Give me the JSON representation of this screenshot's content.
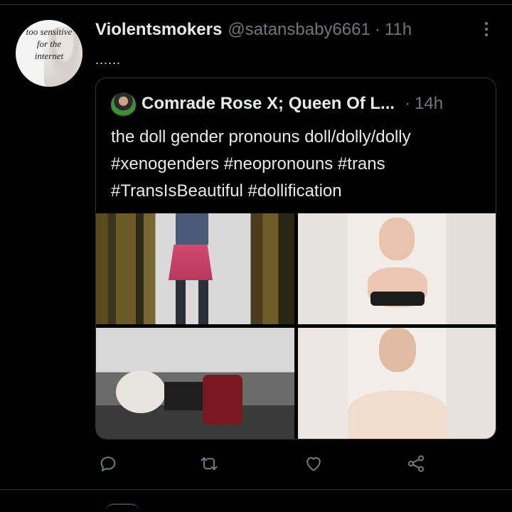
{
  "tweet": {
    "display_name": "Violentsmokers",
    "handle": "@satansbaby6661",
    "separator": "·",
    "time": "11h",
    "text": "......",
    "avatar_text": [
      "too sensitive",
      "for the",
      "internet"
    ],
    "more_icon": "more-dots-icon"
  },
  "quote": {
    "display_name": "Comrade Rose X; Queen Of L...",
    "separator": "·",
    "time": "14h",
    "lines": [
      "the doll gender pronouns doll/dolly/dolly",
      "#xenogenders #neopronouns #trans",
      "#TransIsBeautiful  #dollification"
    ]
  },
  "actions": {
    "reply_icon": "reply-icon",
    "retweet_icon": "retweet-icon",
    "like_icon": "like-icon",
    "share_icon": "share-icon"
  },
  "colors": {
    "background": "#000000",
    "text_primary": "#e7e9ea",
    "text_secondary": "#71767b",
    "border": "#2f3336"
  }
}
